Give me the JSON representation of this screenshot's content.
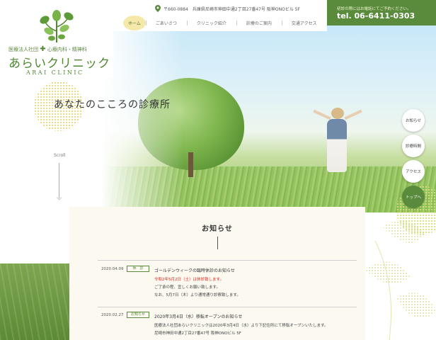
{
  "logo": {
    "subtitle_left": "医療法人社団",
    "subtitle_right": "心療内科・精神科",
    "name": "あらいクリニック",
    "name_en": "ARAI CLINIC"
  },
  "header": {
    "address": "〒660-0884　兵庫県尼崎市神田中通2丁目27番47号 阪神ONOビル 5F",
    "nav": [
      {
        "label": "ホーム",
        "active": true
      },
      {
        "label": "ごあいさつ"
      },
      {
        "label": "クリニック紹介"
      },
      {
        "label": "診療のご案内"
      },
      {
        "label": "交通アクセス"
      }
    ],
    "phone_note": "初診の際にはお電話にてご予約ください。",
    "phone": "tel. 06-6411-0303"
  },
  "hero": {
    "tagline": "あなたのこころの診療所",
    "scroll_label": "Scroll"
  },
  "side_buttons": [
    {
      "label": "お知らせ"
    },
    {
      "label": "診療時間"
    },
    {
      "label": "アクセス"
    },
    {
      "label": "トップへ"
    }
  ],
  "news": {
    "title": "お知らせ",
    "items": [
      {
        "date": "2020.04.09",
        "tag": "休　診",
        "headline": "ゴールデンウィークの臨時休診のお知らせ",
        "lines": [
          {
            "text": "令和2年5月2日（土）は休診致します。",
            "style": "red"
          },
          {
            "text": "ご了承の程、宜しくお願い致します。",
            "style": "normal"
          },
          {
            "text": "なお、5月7日（木）より通常通り診察致します。",
            "style": "normal"
          }
        ]
      },
      {
        "date": "2020.02.27",
        "tag": "お知らせ",
        "headline": "2020年3月4日（水）移転オープンのお知らせ",
        "lines": [
          {
            "text": "医療法人社団あらいクリニックは2020年3月4日（水）より下記住所にて移転オープンいたします。",
            "style": "normal"
          },
          {
            "text": "尼崎市神田中通2丁目27番47号 阪神ONOビル 5F",
            "style": "normal"
          }
        ]
      }
    ]
  },
  "colors": {
    "brand_green": "#5a8b3c",
    "notice_red": "#d62a1f",
    "nav_active_bg": "#f4e9a9",
    "news_bg": "#fbf9f0"
  }
}
